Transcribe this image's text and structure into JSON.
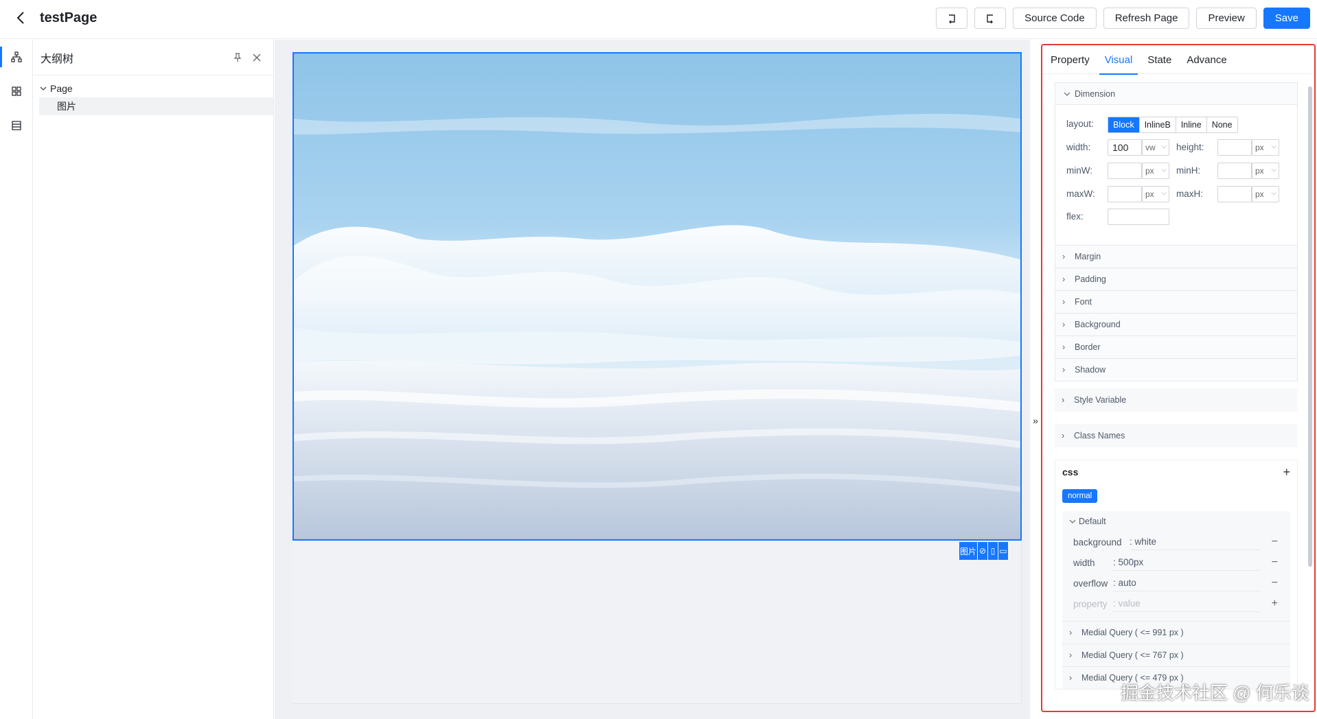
{
  "header": {
    "title": "testPage",
    "buttons": {
      "source_code": "Source Code",
      "refresh_page": "Refresh Page",
      "preview": "Preview",
      "save": "Save"
    }
  },
  "outline": {
    "title": "大纲树",
    "tree": {
      "root": "Page",
      "child": "图片"
    }
  },
  "canvas": {
    "selection_label": "图片"
  },
  "right_panel": {
    "tabs": [
      "Property",
      "Visual",
      "State",
      "Advance"
    ],
    "active_tab": "Visual",
    "dimension": {
      "title": "Dimension",
      "layout_label": "layout:",
      "layout_options": [
        "Block",
        "InlineB",
        "Inline",
        "None"
      ],
      "layout_selected": "Block",
      "width_label": "width:",
      "width_value": "100",
      "width_unit": "vw",
      "height_label": "height:",
      "height_unit": "px",
      "minw_label": "minW:",
      "minw_unit": "px",
      "minh_label": "minH:",
      "minh_unit": "px",
      "maxw_label": "maxW:",
      "maxw_unit": "px",
      "maxh_label": "maxH:",
      "maxh_unit": "px",
      "flex_label": "flex:"
    },
    "sections": [
      "Margin",
      "Padding",
      "Font",
      "Background",
      "Border",
      "Shadow"
    ],
    "style_variable": "Style Variable",
    "class_names": "Class Names",
    "css": {
      "title": "css",
      "state_tag": "normal",
      "default_title": "Default",
      "properties": [
        {
          "key": "background",
          "value": ": white"
        },
        {
          "key": "width",
          "value": ": 500px"
        },
        {
          "key": "overflow",
          "value": ": auto"
        }
      ],
      "placeholder_key": "property",
      "placeholder_value": "value",
      "media_queries": [
        "Medial Query ( <= 991 px )",
        "Medial Query ( <= 767 px )",
        "Medial Query ( <= 479 px )"
      ]
    }
  },
  "watermark": "掘金技术社区 @ 何乐谈",
  "colors": {
    "accent": "#1677ff",
    "highlight_border": "#e53935"
  }
}
